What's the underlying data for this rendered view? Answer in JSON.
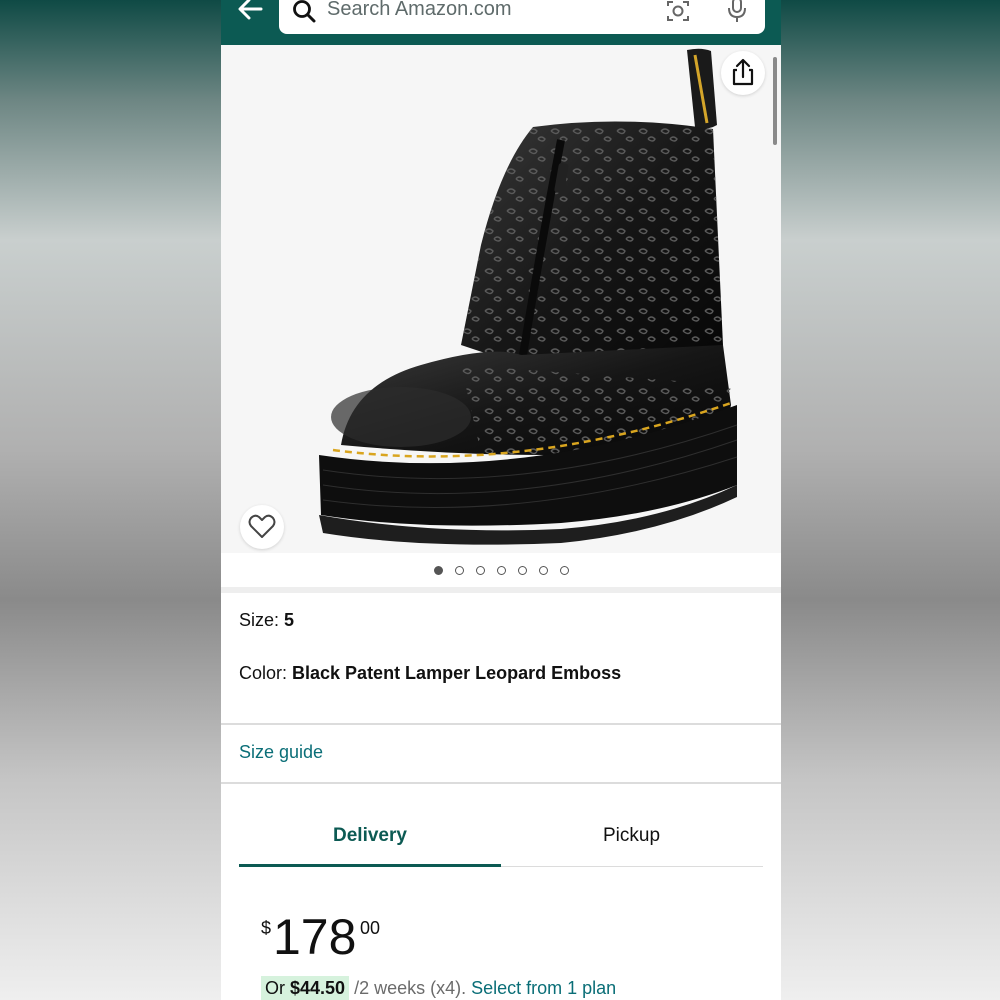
{
  "header": {
    "search_placeholder": "Search Amazon.com",
    "icons": [
      "back-arrow-icon",
      "search-icon",
      "camera-lens-icon",
      "microphone-icon"
    ]
  },
  "gallery": {
    "image_alt": "Black patent leopard emboss platform boot",
    "share_icon": "share-icon",
    "wishlist_icon": "heart-icon",
    "dot_count": 7,
    "active_dot": 0
  },
  "attributes": {
    "size_label": "Size: ",
    "size_value": "5",
    "color_label": "Color: ",
    "color_value": "Black Patent Lamper Leopard Emboss"
  },
  "links": {
    "size_guide": "Size guide"
  },
  "tabs": [
    {
      "label": "Delivery",
      "selected": true
    },
    {
      "label": "Pickup",
      "selected": false
    }
  ],
  "price": {
    "symbol": "$",
    "whole": "178",
    "fraction": "00"
  },
  "plan": {
    "or_text": "Or ",
    "installment": "$44.50",
    "period": " /2 weeks (x4). ",
    "link": "Select from 1 plan"
  },
  "colors": {
    "header_bg": "#0c5a53",
    "link": "#0a6e77",
    "badge_bg": "#d6f2dd"
  }
}
